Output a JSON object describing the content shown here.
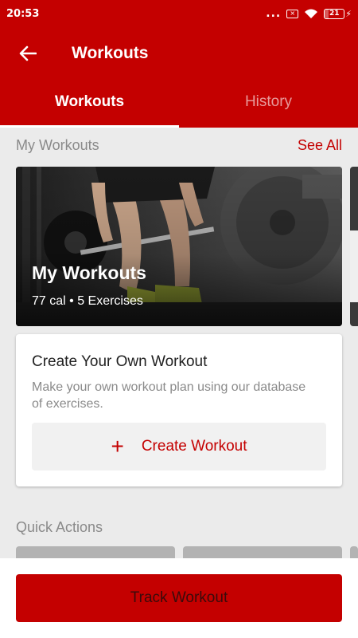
{
  "status_bar": {
    "time": "20:53",
    "dots": "...",
    "sim_label": "×",
    "battery": "21",
    "battery_level": 0.21
  },
  "app_bar": {
    "title": "Workouts",
    "back_icon": "arrow-left-icon"
  },
  "tabs": [
    {
      "label": "Workouts",
      "active": true
    },
    {
      "label": "History",
      "active": false
    }
  ],
  "my_workouts": {
    "section_title": "My Workouts",
    "see_all": "See All",
    "card": {
      "title": "My Workouts",
      "meta": "77 cal • 5 Exercises"
    }
  },
  "create_card": {
    "title": "Create Your Own Workout",
    "description": "Make your own workout plan using our database of exercises.",
    "button_label": "Create Workout",
    "button_icon": "plus-icon"
  },
  "quick_actions": {
    "title": "Quick Actions"
  },
  "bottom": {
    "track_label": "Track Workout"
  },
  "colors": {
    "primary": "#c40000",
    "background": "#ebebeb",
    "muted_text": "#8a8a8a"
  }
}
